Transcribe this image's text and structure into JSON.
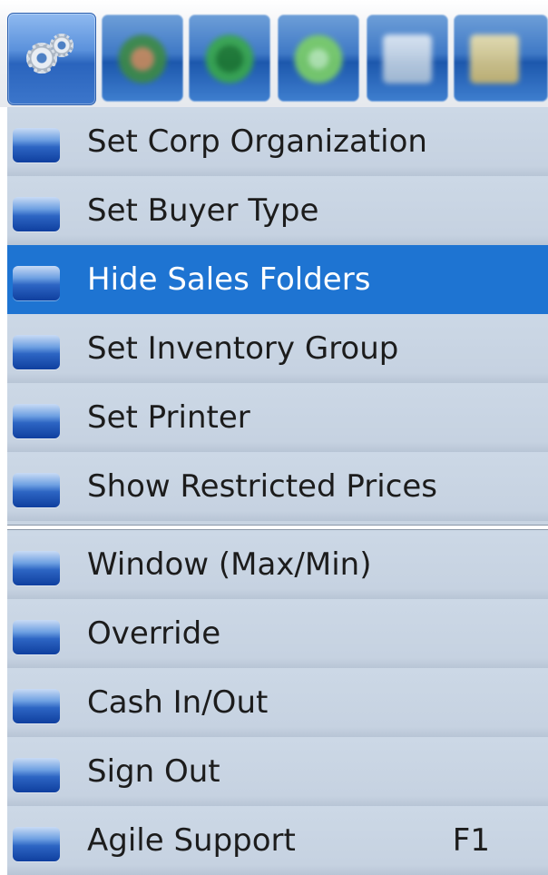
{
  "toolbar": {
    "buttons": [
      {
        "name": "settings",
        "icon": "gears-icon",
        "active": true
      },
      {
        "name": "tool-2",
        "icon": "user-group-icon",
        "color": "#3d8a44"
      },
      {
        "name": "tool-3",
        "icon": "green-circle-icon",
        "color": "#2e9a3c"
      },
      {
        "name": "tool-4",
        "icon": "lime-circle-icon",
        "color": "#7ccf66"
      },
      {
        "name": "tool-5",
        "icon": "card-icon",
        "color": "#c9d8e6"
      },
      {
        "name": "tool-6",
        "icon": "folder-icon",
        "color": "#d8c98a"
      }
    ]
  },
  "menu": {
    "group1": [
      {
        "label": "Set Corp Organization",
        "shortcut": ""
      },
      {
        "label": "Set Buyer Type",
        "shortcut": ""
      },
      {
        "label": "Hide Sales Folders",
        "shortcut": "",
        "highlighted": true
      },
      {
        "label": "Set Inventory Group",
        "shortcut": ""
      },
      {
        "label": "Set Printer",
        "shortcut": ""
      },
      {
        "label": "Show Restricted Prices",
        "shortcut": ""
      }
    ],
    "group2": [
      {
        "label": "Window (Max/Min)",
        "shortcut": ""
      },
      {
        "label": "Override",
        "shortcut": ""
      },
      {
        "label": "Cash In/Out",
        "shortcut": ""
      },
      {
        "label": "Sign Out",
        "shortcut": ""
      },
      {
        "label": "Agile Support",
        "shortcut": "F1"
      }
    ]
  },
  "colors": {
    "highlight": "#1e74d2",
    "menu_bg": "#c8d4e2",
    "bullet": "#2d65c3"
  }
}
